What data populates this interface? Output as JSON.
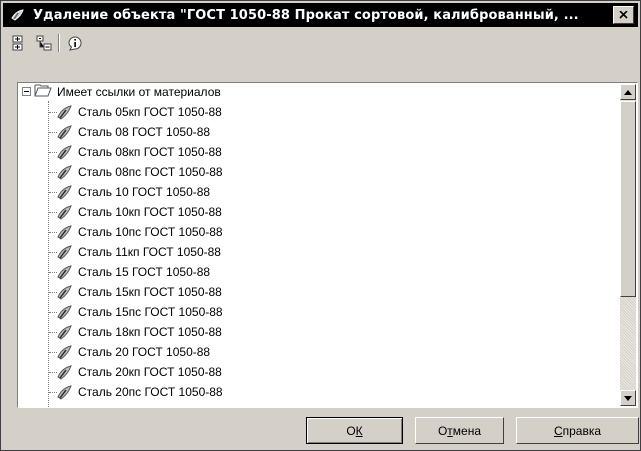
{
  "window": {
    "title": "Удаление объекта \"ГОСТ 1050-88 Прокат сортовой, калиброванный, ...",
    "title_icon": "material-app-icon",
    "close_icon": "close-icon"
  },
  "toolbar": {
    "buttons": [
      {
        "name": "expand-all-icon"
      },
      {
        "name": "collapse-tree-icon"
      },
      {
        "name": "info-icon"
      }
    ]
  },
  "tree": {
    "root_label": "Имеет ссылки от материалов",
    "items": [
      "Сталь 05кп ГОСТ 1050-88",
      "Сталь 08 ГОСТ 1050-88",
      "Сталь 08кп ГОСТ 1050-88",
      "Сталь 08пс ГОСТ 1050-88",
      "Сталь 10 ГОСТ 1050-88",
      "Сталь 10кп ГОСТ 1050-88",
      "Сталь 10пс ГОСТ 1050-88",
      "Сталь 11кп ГОСТ 1050-88",
      "Сталь 15 ГОСТ 1050-88",
      "Сталь 15кп ГОСТ 1050-88",
      "Сталь 15пс ГОСТ 1050-88",
      "Сталь 18кп ГОСТ 1050-88",
      "Сталь 20 ГОСТ 1050-88",
      "Сталь 20кп ГОСТ 1050-88",
      "Сталь 20пс ГОСТ 1050-88"
    ]
  },
  "buttons": {
    "ok_prefix": "О",
    "ok_mnemonic": "К",
    "cancel_prefix": "О",
    "cancel_mnemonic": "т",
    "cancel_rest": "мена",
    "help_prefix": "",
    "help_mnemonic": "С",
    "help_rest": "правка"
  }
}
